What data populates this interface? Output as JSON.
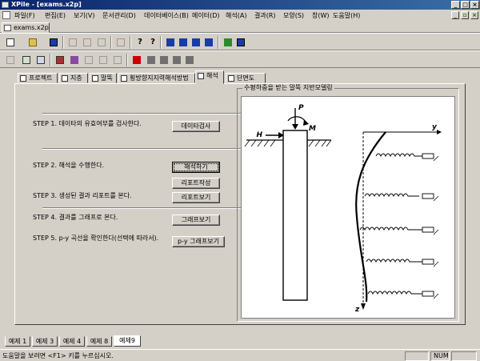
{
  "window": {
    "title": "XPile - [exams.x2p]"
  },
  "menu": [
    "파일(F)",
    "편집(E)",
    "보기(V)",
    "문서관리(D)",
    "데이터베이스(B)",
    "메이터(D)",
    "해석(A)",
    "결과(R)",
    "모양(S)",
    "창(W)",
    "도움말(H)"
  ],
  "doc_tab": "exams.x2p",
  "tabs": [
    "프로젝트",
    "지층",
    "말뚝",
    "횡방향지지력해석방법",
    "해석",
    "단면도"
  ],
  "active_tab": "해석",
  "steps": {
    "step1": {
      "text": "STEP 1. 데이타의 유효여부를 검사한다.",
      "button": "데이타검사"
    },
    "step2": {
      "text": "STEP 2. 해석을 수행한다.",
      "button": "해석하기",
      "button2": "리포트작성"
    },
    "step3": {
      "text": "STEP 3. 생성된 결과 리포트를 본다.",
      "button": "리포트보기"
    },
    "step4": {
      "text": "STEP 4. 결과를 그래프로 본다.",
      "button": "그래프보기"
    },
    "step5": {
      "text": "STEP 5. p-y 곡선을 확인한다(선택에 따라서).",
      "button": "p-y 그래프보기"
    }
  },
  "figure": {
    "title": "수평하중을 받는 말뚝 지반모델링",
    "label_p": "P",
    "label_h": "H",
    "label_m": "M",
    "label_y": "y",
    "label_z": "z"
  },
  "bottom_tabs": [
    "예제 1",
    "예제 3",
    "예제 4",
    "예제 8",
    "예제9"
  ],
  "active_bottom_tab": "예제9",
  "status": {
    "message": "도움말을 보려면 <F1> 키를 누르십시오.",
    "num": "NUM"
  },
  "colors": {
    "titlebar": "#0a246a",
    "face": "#d4d0c8",
    "red_icon": "#cc0000",
    "blue_icon": "#1a3ca8"
  }
}
